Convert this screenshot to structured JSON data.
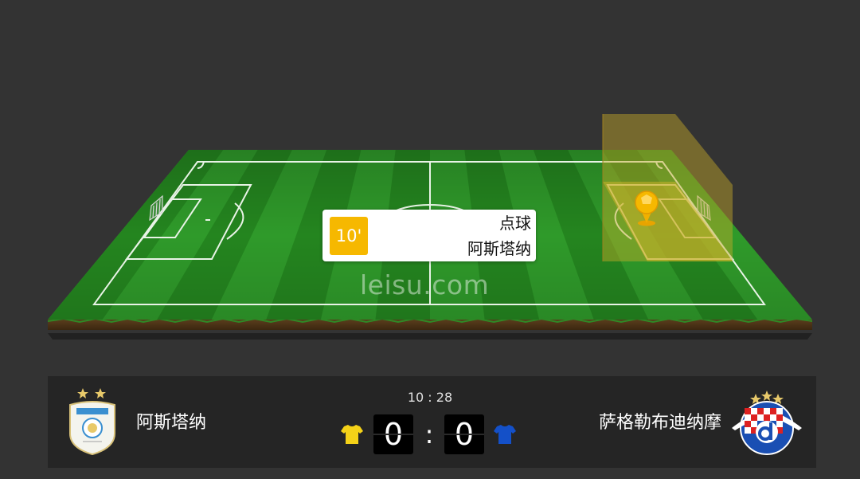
{
  "pitch": {
    "watermark": "leisu.com",
    "attack_zone": "away-penalty-area",
    "event_icon": "penalty-ball-icon"
  },
  "event": {
    "minute": "10'",
    "type": "点球",
    "team": "阿斯塔纳"
  },
  "match": {
    "time": "10 : 28",
    "separator": ":"
  },
  "home": {
    "name": "阿斯塔纳",
    "score": "0",
    "shirt_color": "#f5d218",
    "crest": "astana-crest-icon"
  },
  "away": {
    "name": "萨格勒布迪纳摩",
    "score": "0",
    "shirt_color": "#1450c8",
    "crest": "dinamo-zagreb-crest-icon"
  },
  "colors": {
    "background": "#333333",
    "scorebar": "#252525",
    "grass_light": "#2f9a2a",
    "grass_dark": "#24851f",
    "highlight": "#f6b800"
  }
}
